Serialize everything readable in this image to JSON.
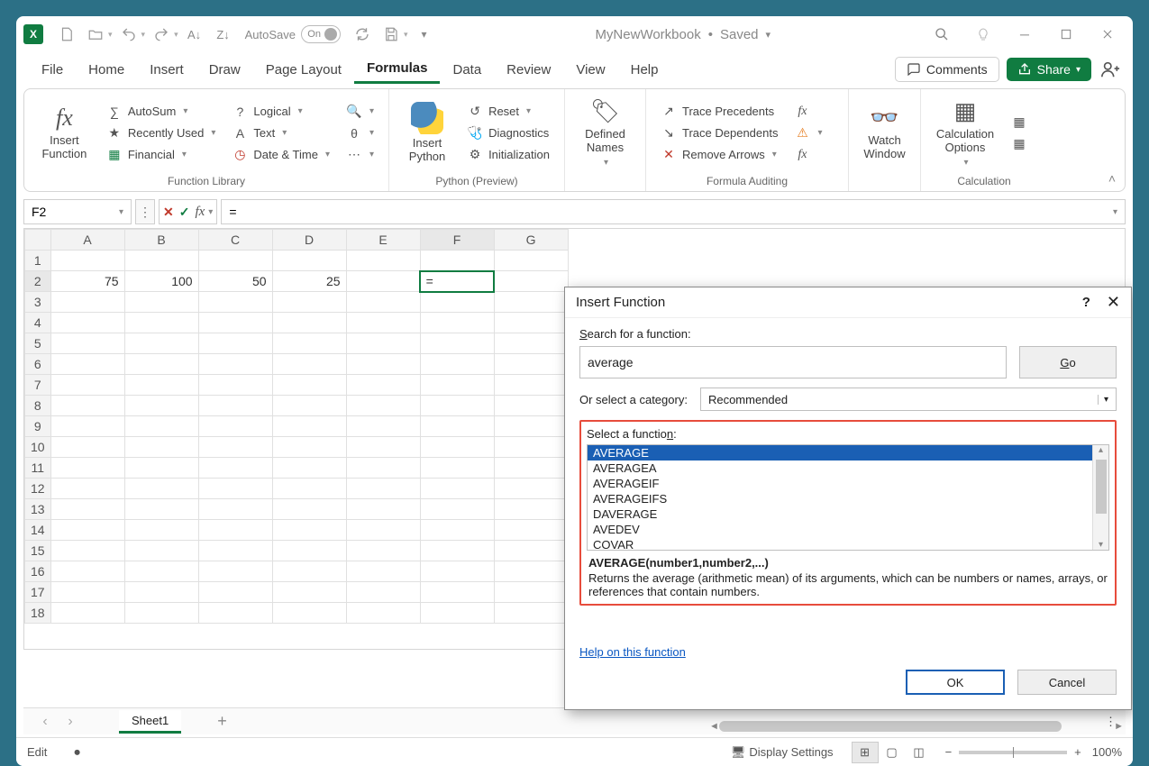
{
  "title": {
    "workbook": "MyNewWorkbook",
    "status": "Saved",
    "sep": "•"
  },
  "autosave": {
    "label": "AutoSave",
    "state": "On"
  },
  "tabs": [
    "File",
    "Home",
    "Insert",
    "Draw",
    "Page Layout",
    "Formulas",
    "Data",
    "Review",
    "View",
    "Help"
  ],
  "active_tab": "Formulas",
  "comments": "Comments",
  "share": "Share",
  "ribbon": {
    "insert_function": "Insert\nFunction",
    "autosum": "AutoSum",
    "recent": "Recently Used",
    "financial": "Financial",
    "logical": "Logical",
    "text": "Text",
    "datetime": "Date & Time",
    "group_fn": "Function Library",
    "insert_python": "Insert\nPython",
    "reset": "Reset",
    "diagnostics": "Diagnostics",
    "init": "Initialization",
    "group_py": "Python (Preview)",
    "defined": "Defined\nNames",
    "trace_prec": "Trace Precedents",
    "trace_dep": "Trace Dependents",
    "remove_arrows": "Remove Arrows",
    "group_audit": "Formula Auditing",
    "watch": "Watch\nWindow",
    "calc_opts": "Calculation\nOptions",
    "group_calc": "Calculation"
  },
  "namebox": "F2",
  "formula": "=",
  "columns": [
    "A",
    "B",
    "C",
    "D",
    "E",
    "F",
    "G"
  ],
  "rows": [
    "1",
    "2",
    "3",
    "4",
    "5",
    "6",
    "7",
    "8",
    "9",
    "10",
    "11",
    "12",
    "13",
    "14",
    "15",
    "16",
    "17",
    "18"
  ],
  "cells": {
    "A2": "75",
    "B2": "100",
    "C2": "50",
    "D2": "25",
    "F2": "="
  },
  "sheet": "Sheet1",
  "statusbar": {
    "mode": "Edit",
    "display": "Display Settings",
    "zoom": "100%"
  },
  "dialog": {
    "title": "Insert Function",
    "search_label": "Search for a function:",
    "search_value": "average",
    "go": "Go",
    "cat_label": "Or select a category:",
    "cat_value": "Recommended",
    "select_label": "Select a function:",
    "list": [
      "AVERAGE",
      "AVERAGEA",
      "AVERAGEIF",
      "AVERAGEIFS",
      "DAVERAGE",
      "AVEDEV",
      "COVAR"
    ],
    "selected": "AVERAGE",
    "signature": "AVERAGE(number1,number2,...)",
    "description": "Returns the average (arithmetic mean) of its arguments, which can be numbers or names, arrays, or references that contain numbers.",
    "help": "Help on this function",
    "ok": "OK",
    "cancel": "Cancel"
  },
  "hscroll": {
    "left": "◄",
    "right": "►"
  }
}
